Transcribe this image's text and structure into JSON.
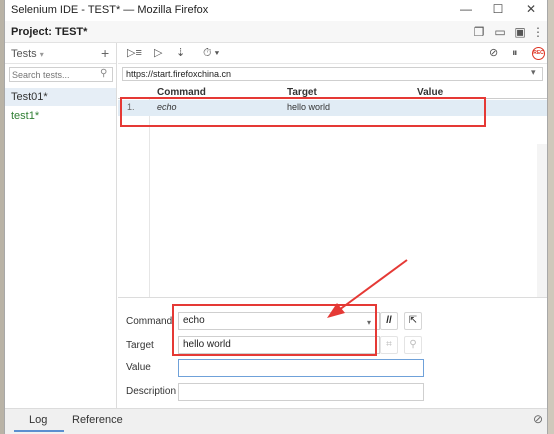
{
  "window": {
    "title": "Selenium IDE - TEST* — Mozilla Firefox",
    "controls": [
      "—",
      "☐",
      "✕"
    ]
  },
  "project": {
    "label": "Project:",
    "name": "TEST*"
  },
  "sidebar": {
    "header": "Tests",
    "header_caret": "▾",
    "add": "+",
    "search_placeholder": "Search tests...",
    "tests": [
      {
        "name": "Test01*",
        "selected": true
      },
      {
        "name": "test1*",
        "selected": false
      }
    ]
  },
  "toolbar": {
    "run_all": "▷≡",
    "run": "▷",
    "step": "⇣",
    "speed": "⏱ ▾",
    "disable_breakpoints": "⊘",
    "pause": "⏸",
    "rec": "REC"
  },
  "url": {
    "value": "https://start.firefoxchina.cn"
  },
  "grid": {
    "headers": [
      "Command",
      "Target",
      "Value"
    ],
    "rows": [
      {
        "num": "1.",
        "command": "echo",
        "target": "hello world",
        "value": ""
      }
    ]
  },
  "editor": {
    "command_label": "Command",
    "command_value": "echo",
    "target_label": "Target",
    "target_value": "hello world",
    "value_label": "Value",
    "value_value": "",
    "description_label": "Description",
    "description_value": "",
    "comment_btn": "//",
    "open_btn": "⇱",
    "select_btn": "⌗",
    "find_btn": "⚲"
  },
  "bottom": {
    "tabs": [
      "Log",
      "Reference"
    ],
    "clear": "⊘"
  },
  "colors": {
    "highlight": "#e53935",
    "selected_row": "#e1ecf5",
    "accent": "#5b8fd0"
  }
}
